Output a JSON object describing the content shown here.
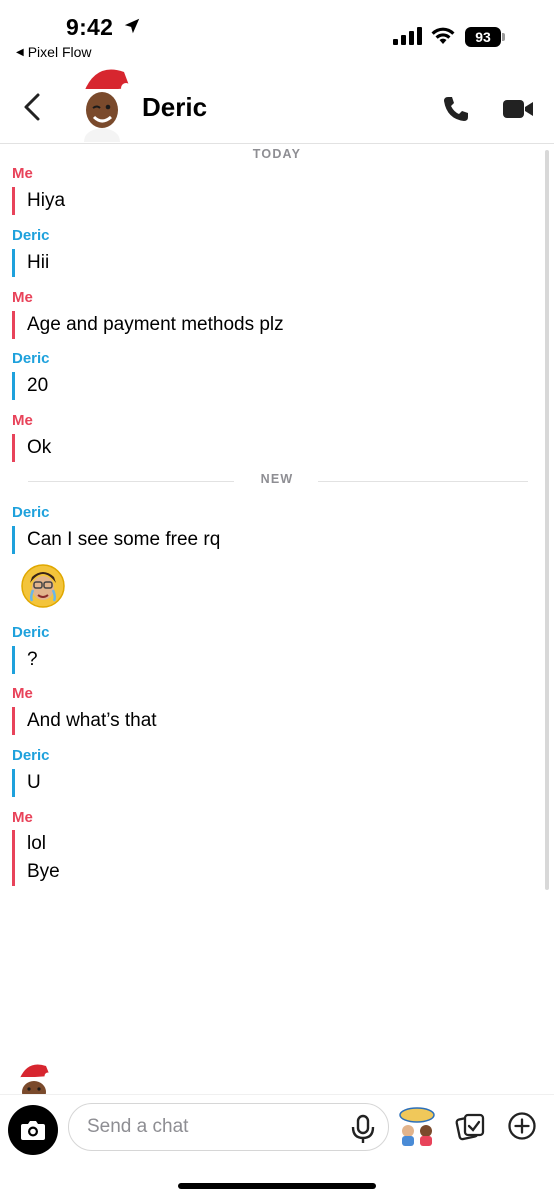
{
  "status_bar": {
    "time": "9:42",
    "back_app_label": "Pixel Flow",
    "battery": "93"
  },
  "header": {
    "name": "Deric"
  },
  "thread": {
    "date_separator": "TODAY",
    "new_separator": "NEW",
    "messages": [
      {
        "sender": "Me",
        "lines": [
          "Hiya"
        ]
      },
      {
        "sender": "Deric",
        "lines": [
          "Hii"
        ]
      },
      {
        "sender": "Me",
        "lines": [
          "Age and payment methods plz"
        ]
      },
      {
        "sender": "Deric",
        "lines": [
          "20"
        ]
      },
      {
        "sender": "Me",
        "lines": [
          "Ok"
        ]
      },
      {
        "sender": "Deric",
        "lines": [
          "Can I see some free rq"
        ]
      },
      {
        "sender": "Deric",
        "lines": [
          "?"
        ]
      },
      {
        "sender": "Me",
        "lines": [
          "And what’s that"
        ]
      },
      {
        "sender": "Deric",
        "lines": [
          "U"
        ]
      },
      {
        "sender": "Me",
        "lines": [
          "lol",
          "Bye"
        ]
      }
    ]
  },
  "composer": {
    "placeholder": "Send a chat"
  },
  "colors": {
    "me": "#e8435a",
    "deric": "#1ea1dc"
  },
  "icons": [
    "location-arrow-icon",
    "signal-icon",
    "wifi-icon",
    "back-chevron-icon",
    "phone-icon",
    "video-icon",
    "camera-icon",
    "microphone-icon",
    "sticker-icon",
    "memories-icon",
    "plus-icon"
  ]
}
